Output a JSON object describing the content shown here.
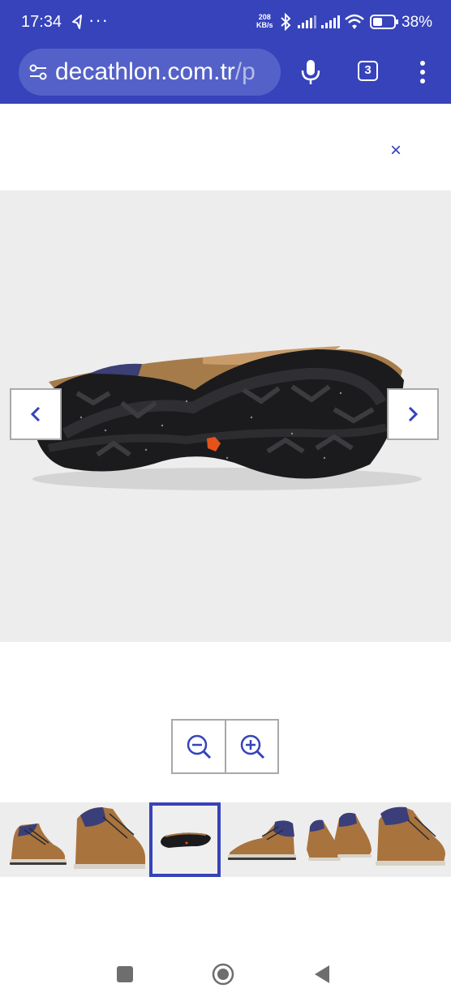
{
  "status_bar": {
    "time": "17:34",
    "overflow": "···",
    "speed_value": "208",
    "speed_unit": "KB/s",
    "battery_percent": "38%",
    "icons": [
      "location-icon",
      "bluetooth-icon",
      "signal-icon",
      "signal-icon",
      "wifi-icon",
      "battery-icon"
    ]
  },
  "browser": {
    "url_main": "decathlon.com.tr",
    "url_rest": "/p",
    "tab_count": "3",
    "icons": [
      "tune-icon",
      "microphone-icon",
      "tabs-icon",
      "more-vert-icon"
    ]
  },
  "viewer": {
    "close_symbol": "×",
    "accent_color": "#3643ba",
    "background_color": "#ededed",
    "main_image": "hiking-shoe-sole",
    "icons": [
      "close-icon",
      "chevron-left-icon",
      "chevron-right-icon",
      "zoom-out-icon",
      "zoom-in-icon"
    ]
  },
  "thumbnails": {
    "selected": 3,
    "items": [
      "boot-side-left",
      "boot-angled-front",
      "boot-sole",
      "boot-side-right",
      "boot-pair",
      "boot-angled-back"
    ]
  },
  "system_nav": {
    "icons": [
      "recents-icon",
      "home-icon",
      "back-icon"
    ]
  }
}
